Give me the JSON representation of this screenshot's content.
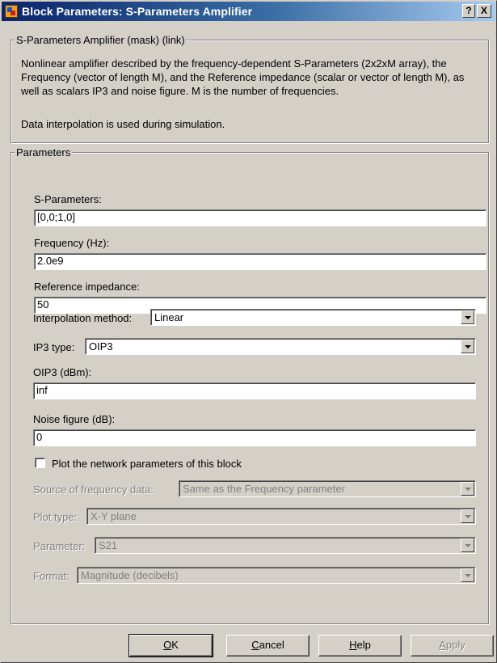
{
  "window": {
    "title": "Block Parameters: S-Parameters Amplifier",
    "help_button": "?",
    "close_button": "X"
  },
  "mask_group": {
    "legend": "S-Parameters Amplifier (mask) (link)",
    "description": "Nonlinear amplifier described by the frequency-dependent S-Parameters (2x2xM array), the Frequency (vector of length M), and the Reference impedance (scalar or vector of length M), as well as scalars IP3 and noise figure. M is the number of frequencies.",
    "note": "Data interpolation is used during simulation."
  },
  "params_group": {
    "legend": "Parameters",
    "s_parameters": {
      "label": "S-Parameters:",
      "value": "[0,0;1,0]"
    },
    "frequency": {
      "label": "Frequency (Hz):",
      "value": "2.0e9"
    },
    "reference_impedance": {
      "label": "Reference impedance:",
      "value": "50"
    },
    "interpolation_method": {
      "label": "Interpolation method:",
      "value": "Linear"
    },
    "ip3_type": {
      "label": "IP3 type:",
      "value": "OIP3"
    },
    "oip3": {
      "label": "OIP3 (dBm):",
      "value": "inf"
    },
    "noise_figure": {
      "label": "Noise figure (dB):",
      "value": "0"
    },
    "plot_checkbox": {
      "label": "Plot the network parameters of this block",
      "checked": false
    },
    "source_of_frequency_data": {
      "label": "Source of frequency data:",
      "value": "Same as the Frequency parameter"
    },
    "plot_type": {
      "label": "Plot type:",
      "value": "X-Y plane"
    },
    "parameter": {
      "label": "Parameter:",
      "value": "S21"
    },
    "format": {
      "label": "Format:",
      "value": "Magnitude (decibels)"
    }
  },
  "buttons": {
    "ok": {
      "mnemonic": "O",
      "rest": "K"
    },
    "cancel": {
      "mnemonic": "C",
      "rest": "ancel"
    },
    "help": {
      "mnemonic": "H",
      "rest": "elp"
    },
    "apply": {
      "mnemonic": "A",
      "rest": "pply"
    }
  },
  "colors": {
    "dialog_bg": "#d4d0c8",
    "titlebar_start": "#0a246a",
    "titlebar_end": "#a6caf0",
    "disabled_text": "#808080"
  }
}
